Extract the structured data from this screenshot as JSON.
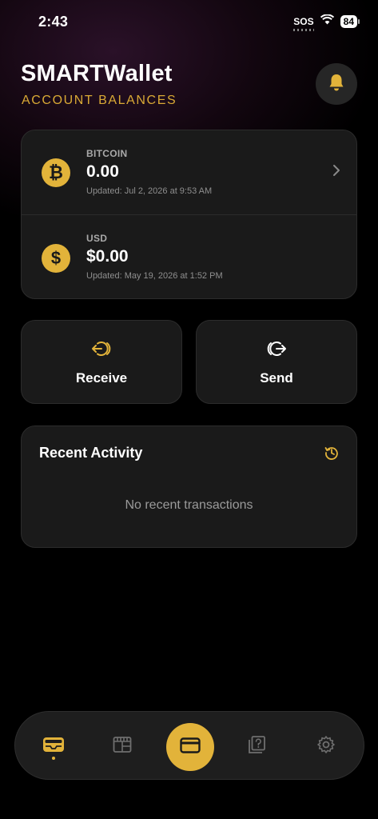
{
  "status_bar": {
    "time": "2:43",
    "sos": "SOS",
    "battery": "84"
  },
  "header": {
    "title": "SMARTWallet",
    "subtitle": "ACCOUNT BALANCES"
  },
  "balances": [
    {
      "label": "BITCOIN",
      "symbol": "₿",
      "value": "0.00",
      "updated": "Updated: Jul 2, 2026 at 9:53 AM",
      "icon": "bitcoin-icon"
    },
    {
      "label": "USD",
      "symbol": "$",
      "value": "$0.00",
      "updated": "Updated: May 19, 2026 at 1:52 PM",
      "icon": "dollar-icon"
    }
  ],
  "actions": {
    "receive_label": "Receive",
    "send_label": "Send"
  },
  "activity": {
    "title": "Recent Activity",
    "empty_text": "No recent transactions"
  },
  "tab_bar": {
    "tabs": [
      "wallet-icon",
      "calendar-icon",
      "card-icon",
      "help-icon",
      "gear-icon"
    ],
    "active": "wallet-icon"
  },
  "colors": {
    "accent": "#e2b33a",
    "card_bg": "#1a1a1a",
    "background": "#000000"
  }
}
